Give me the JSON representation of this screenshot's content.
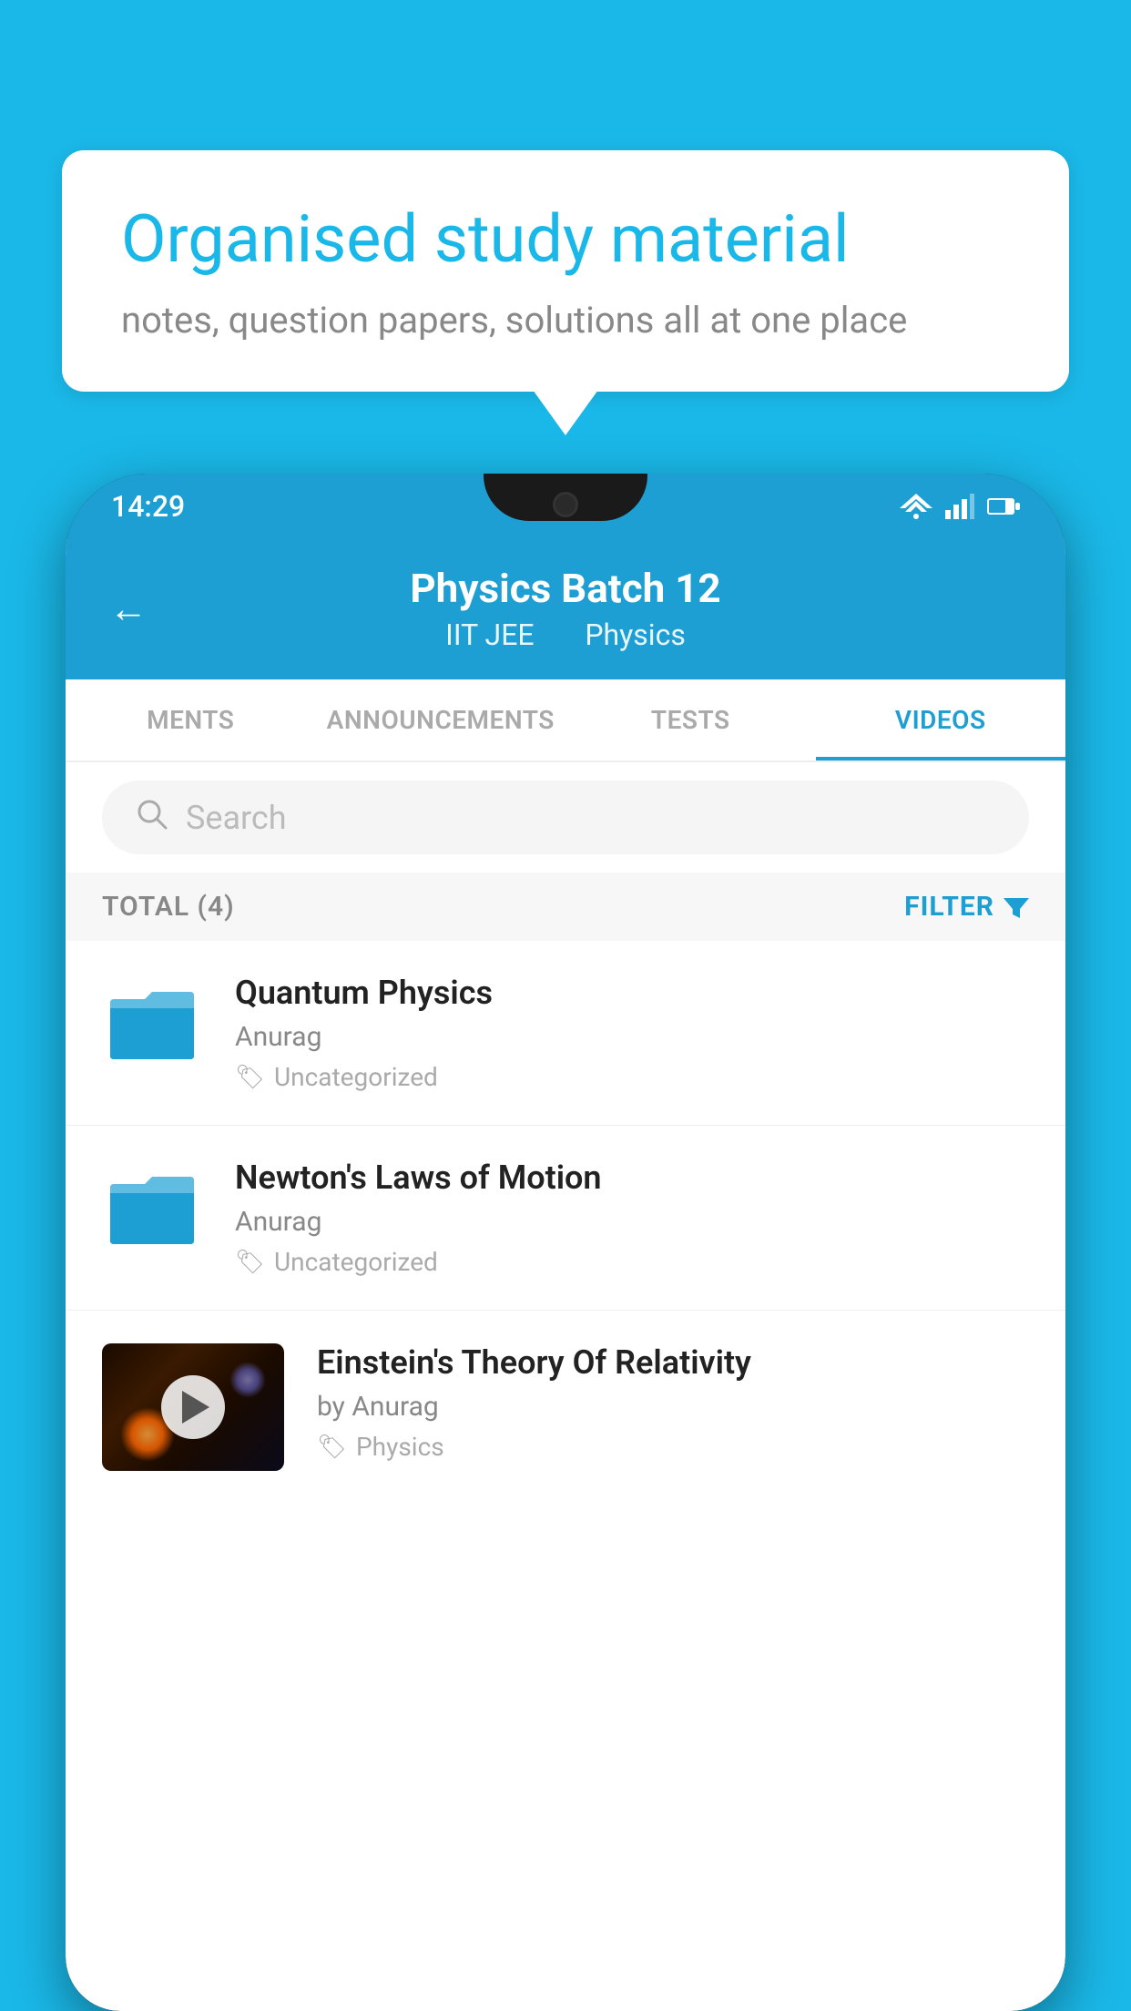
{
  "bubble": {
    "title": "Organised study material",
    "subtitle": "notes, question papers, solutions all at one place"
  },
  "status_bar": {
    "time": "14:29"
  },
  "header": {
    "title": "Physics Batch 12",
    "subtitle_part1": "IIT JEE",
    "subtitle_part2": "Physics"
  },
  "tabs": [
    {
      "label": "MENTS",
      "active": false
    },
    {
      "label": "ANNOUNCEMENTS",
      "active": false
    },
    {
      "label": "TESTS",
      "active": false
    },
    {
      "label": "VIDEOS",
      "active": true
    }
  ],
  "search": {
    "placeholder": "Search"
  },
  "filter_row": {
    "total_label": "TOTAL (4)",
    "filter_label": "FILTER"
  },
  "videos": [
    {
      "id": 1,
      "title": "Quantum Physics",
      "author": "Anurag",
      "tag": "Uncategorized",
      "type": "folder"
    },
    {
      "id": 2,
      "title": "Newton's Laws of Motion",
      "author": "Anurag",
      "tag": "Uncategorized",
      "type": "folder"
    },
    {
      "id": 3,
      "title": "Einstein's Theory Of Relativity",
      "author": "by Anurag",
      "tag": "Physics",
      "type": "video"
    }
  ]
}
